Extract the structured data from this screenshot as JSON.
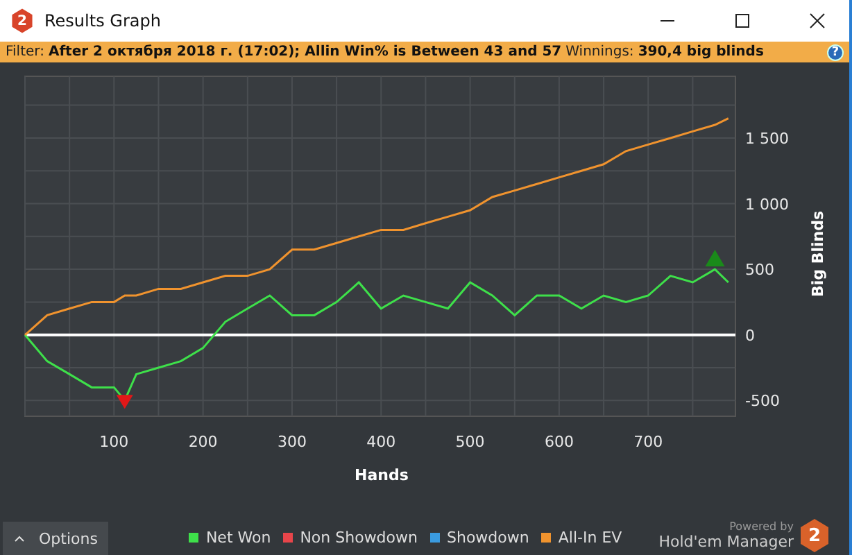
{
  "window": {
    "title": "Results Graph",
    "icon_label": "2"
  },
  "filter_bar": {
    "filter_label": "Filter:",
    "filter_value": "After 2 октября 2018 г. (17:02); Allin Win% is Between 43 and 57",
    "winnings_label": "Winnings:",
    "winnings_value": "390,4 big blinds",
    "help": "?"
  },
  "chart_data": {
    "type": "line",
    "xlabel": "Hands",
    "ylabel": "Big Blinds",
    "grid": true,
    "x": [
      0,
      25,
      50,
      75,
      100,
      112,
      125,
      150,
      175,
      200,
      225,
      250,
      275,
      300,
      325,
      350,
      375,
      400,
      425,
      450,
      475,
      500,
      525,
      550,
      575,
      600,
      625,
      650,
      675,
      700,
      725,
      750,
      775,
      790
    ],
    "series": [
      {
        "name": "Net Won",
        "color": "#3ee04a",
        "values": [
          0,
          -200,
          -300,
          -400,
          -400,
          -500,
          -300,
          -250,
          -200,
          -100,
          100,
          200,
          300,
          150,
          150,
          250,
          400,
          200,
          300,
          250,
          200,
          400,
          300,
          150,
          300,
          300,
          200,
          300,
          250,
          300,
          450,
          400,
          500,
          400
        ]
      },
      {
        "name": "Non Showdown",
        "color": "#e8454a",
        "values": [
          null,
          null,
          null,
          null,
          null,
          null,
          null,
          null,
          null,
          null,
          null,
          null,
          null,
          null,
          null,
          null,
          null,
          null,
          null,
          null,
          null,
          null,
          null,
          null,
          null,
          null,
          null,
          null,
          null,
          null,
          null,
          null,
          null,
          null
        ]
      },
      {
        "name": "Showdown",
        "color": "#3a9be0",
        "values": [
          null,
          null,
          null,
          null,
          null,
          null,
          null,
          null,
          null,
          null,
          null,
          null,
          null,
          null,
          null,
          null,
          null,
          null,
          null,
          null,
          null,
          null,
          null,
          null,
          null,
          null,
          null,
          null,
          null,
          null,
          null,
          null,
          null,
          null
        ]
      },
      {
        "name": "All-In EV",
        "color": "#f0932e",
        "values": [
          0,
          150,
          200,
          250,
          250,
          300,
          300,
          350,
          350,
          400,
          450,
          450,
          500,
          650,
          650,
          700,
          750,
          800,
          800,
          850,
          900,
          950,
          1050,
          1100,
          1150,
          1200,
          1250,
          1300,
          1400,
          1450,
          1500,
          1550,
          1600,
          1650
        ]
      }
    ],
    "xlim": [
      0,
      798
    ],
    "ylim": [
      -620,
      1970
    ],
    "xticks": [
      100,
      200,
      300,
      400,
      500,
      600,
      700
    ],
    "yticks": [
      {
        "value": -500,
        "label": "-500"
      },
      {
        "value": 0,
        "label": "0"
      },
      {
        "value": 500,
        "label": "500"
      },
      {
        "value": 1000,
        "label": "1 000"
      },
      {
        "value": 1500,
        "label": "1 500"
      }
    ]
  },
  "options_button": {
    "label": "Options",
    "expanded": false
  },
  "branding": {
    "powered_by": "Powered by",
    "product": "Hold'em Manager",
    "logo_label": "2"
  }
}
